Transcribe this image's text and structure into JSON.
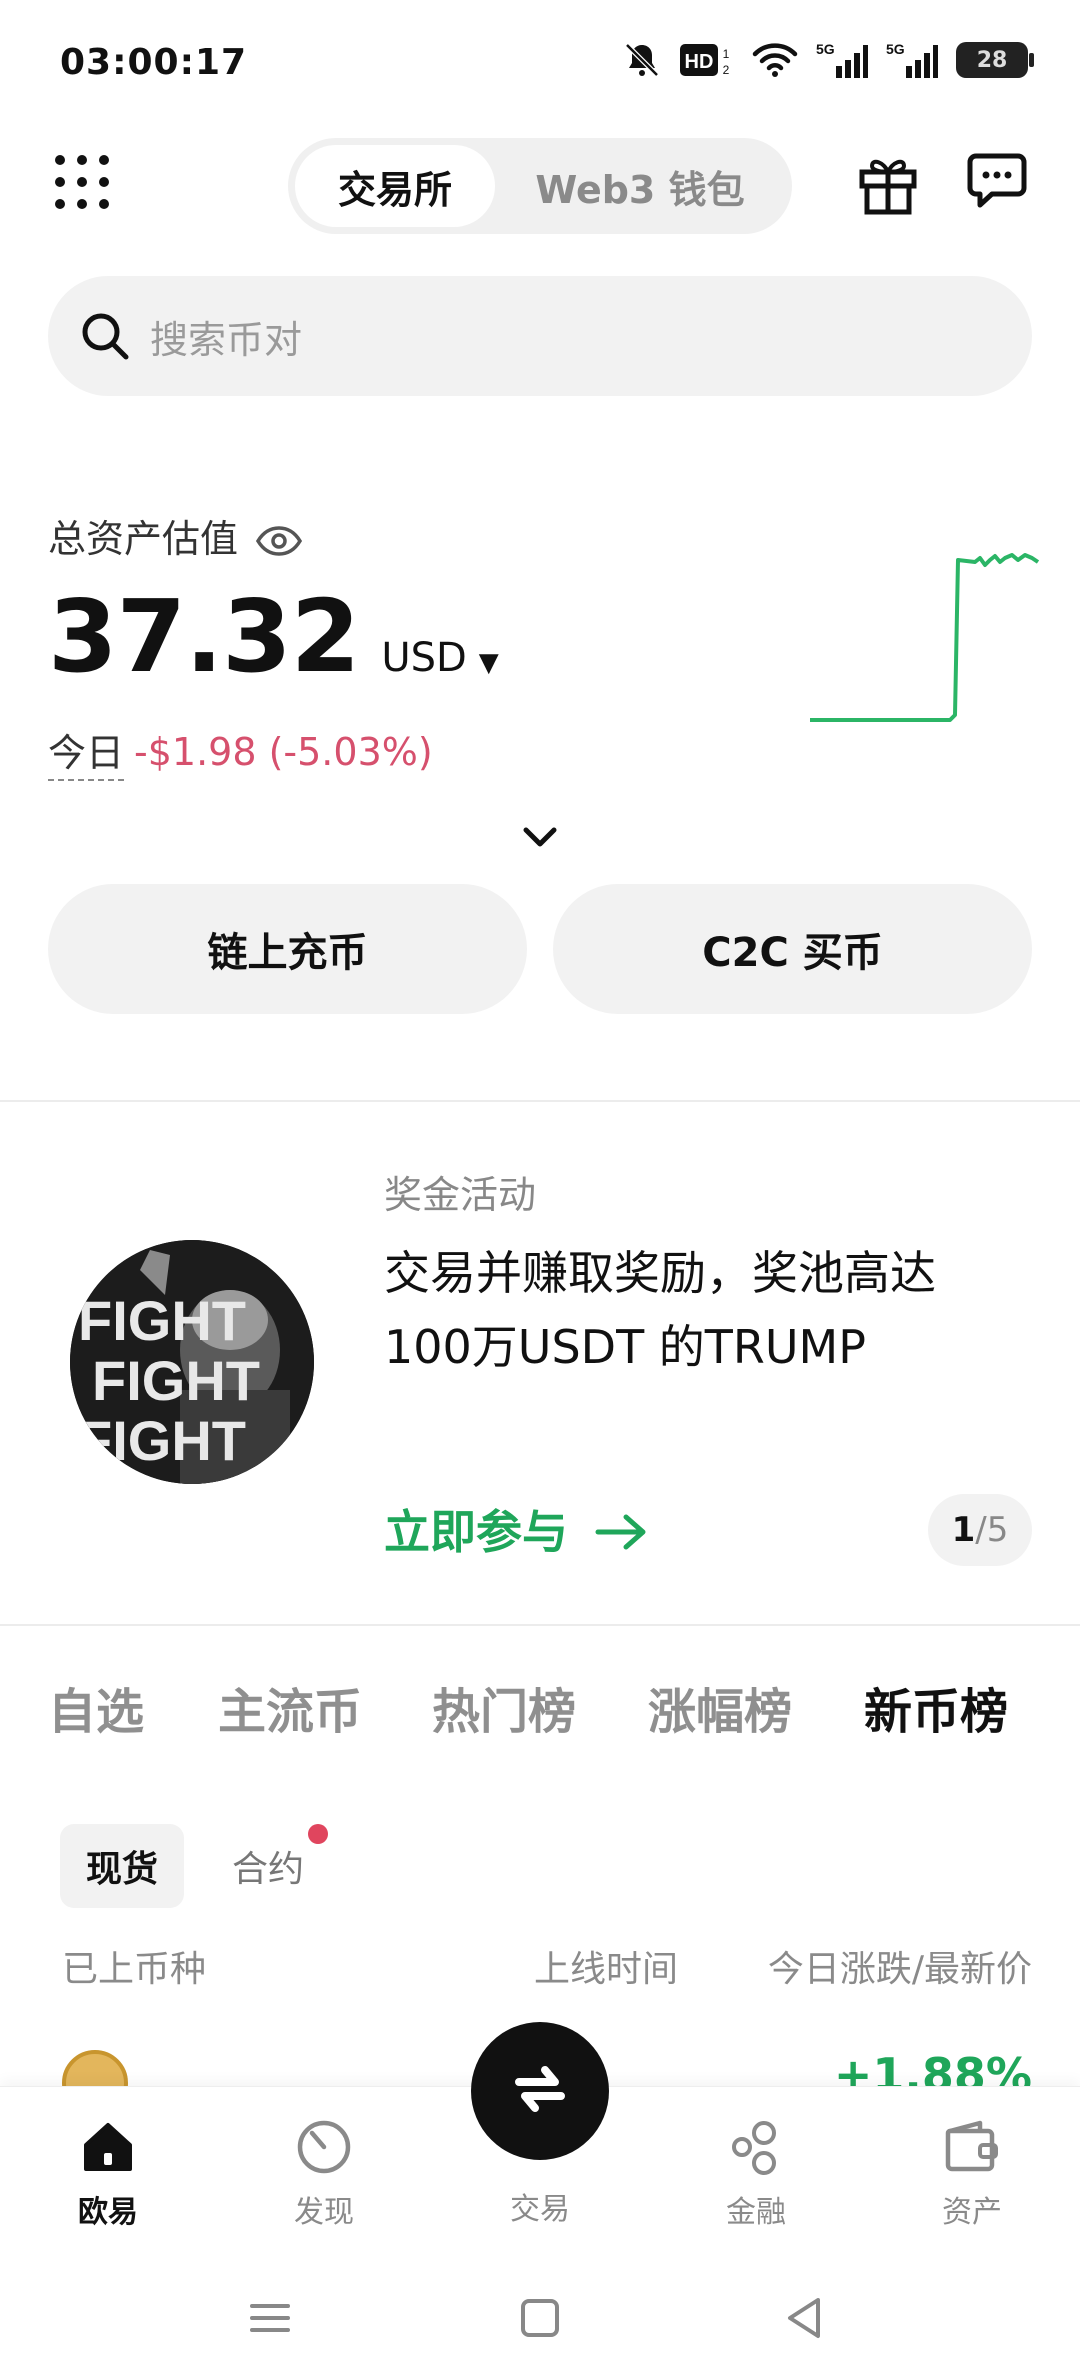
{
  "status_bar": {
    "time": "03:00:17",
    "battery": "28",
    "hd_badge": "HD",
    "network_1": "5G",
    "network_2": "5G"
  },
  "header": {
    "tabs": [
      {
        "label": "交易所",
        "active": true
      },
      {
        "label": "Web3 钱包",
        "active": false
      }
    ]
  },
  "search": {
    "placeholder": "搜索币对"
  },
  "assets": {
    "label": "总资产估值",
    "value": "37.32",
    "currency": "USD",
    "today_label": "今日",
    "today_change": "-$1.98 (-5.03%)",
    "change_color": "#d6506d",
    "sparkline_color": "#2bb566"
  },
  "actions": {
    "deposit": "链上充币",
    "c2c": "C2C 买币"
  },
  "promo": {
    "tag": "奖金活动",
    "title_line1": "交易并赚取奖励，奖池高达",
    "title_line2": "100万USDT 的TRUMP",
    "cta": "立即参与",
    "avatar_text": "FIGHT",
    "page_current": "1",
    "page_total": "/5"
  },
  "market": {
    "tabs": [
      {
        "label": "自选",
        "active": false
      },
      {
        "label": "主流币",
        "active": false
      },
      {
        "label": "热门榜",
        "active": false
      },
      {
        "label": "涨幅榜",
        "active": false
      },
      {
        "label": "新币榜",
        "active": true
      }
    ],
    "sub_tabs": [
      {
        "label": "现货",
        "active": true
      },
      {
        "label": "合约",
        "active": false,
        "dot": true
      }
    ],
    "columns": {
      "name": "已上币种",
      "time": "上线时间",
      "change": "今日涨跌/最新价"
    },
    "first_row_change": "+1.88%"
  },
  "bottom_nav": {
    "items": [
      {
        "label": "欧易",
        "icon": "home-icon",
        "active": true
      },
      {
        "label": "发现",
        "icon": "discover-icon",
        "active": false
      },
      {
        "label": "交易",
        "icon": "swap-icon",
        "active": false
      },
      {
        "label": "金融",
        "icon": "finance-icon",
        "active": false
      },
      {
        "label": "资产",
        "icon": "wallet-icon",
        "active": false
      }
    ]
  },
  "colors": {
    "accent_green": "#1fa65a",
    "negative": "#d6506d"
  }
}
